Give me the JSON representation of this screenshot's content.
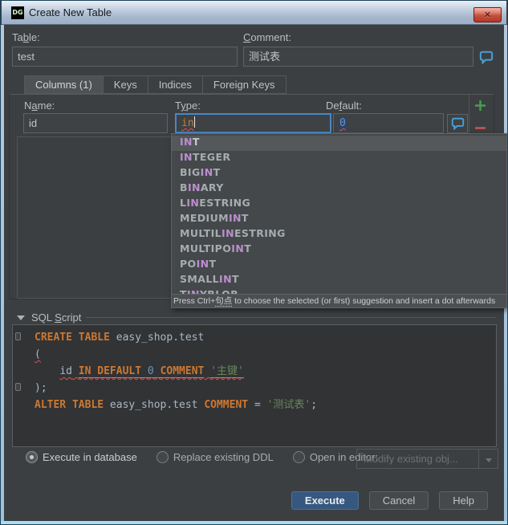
{
  "window": {
    "title": "Create New Table",
    "icon_text": "DG",
    "close_glyph": "✕"
  },
  "header": {
    "table_label": [
      "Ta",
      "b",
      "le:"
    ],
    "table_value": "test",
    "comment_label": [
      "",
      "C",
      "omment:"
    ],
    "comment_value": "测试表"
  },
  "tabs": [
    {
      "label": "Columns (1)",
      "active": true
    },
    {
      "label": "Keys",
      "active": false
    },
    {
      "label": "Indices",
      "active": false
    },
    {
      "label": "Foreign Keys",
      "active": false
    }
  ],
  "columns_tab": {
    "name_label": [
      "N",
      "a",
      "me:"
    ],
    "name_value": "id",
    "type_label": [
      "T",
      "y",
      "pe:"
    ],
    "type_value": "in",
    "default_label": [
      "De",
      "f",
      "ault:"
    ],
    "default_value": "0"
  },
  "completion": {
    "items": [
      {
        "pre": "",
        "match": "IN",
        "post": "T",
        "selected": true
      },
      {
        "pre": "",
        "match": "IN",
        "post": "TEGER",
        "selected": false
      },
      {
        "pre": "BIG",
        "match": "IN",
        "post": "T",
        "selected": false
      },
      {
        "pre": "B",
        "match": "IN",
        "post": "ARY",
        "selected": false
      },
      {
        "pre": "L",
        "match": "IN",
        "post": "ESTRING",
        "selected": false
      },
      {
        "pre": "MEDIUM",
        "match": "IN",
        "post": "T",
        "selected": false
      },
      {
        "pre": "MULTIL",
        "match": "IN",
        "post": "ESTRING",
        "selected": false
      },
      {
        "pre": "MULTIPO",
        "match": "IN",
        "post": "T",
        "selected": false
      },
      {
        "pre": "PO",
        "match": "IN",
        "post": "T",
        "selected": false
      },
      {
        "pre": "SMALL",
        "match": "IN",
        "post": "T",
        "selected": false
      },
      {
        "pre": "T",
        "match": "IN",
        "post": "YBLOB",
        "selected": false
      }
    ],
    "hint": [
      "Press Ctrl+",
      "句点",
      " to choose the selected (or first) suggestion and insert a dot afterwards"
    ]
  },
  "sql_section": {
    "label": [
      "SQL ",
      "S",
      "cript"
    ],
    "lines": [
      [
        [
          "CREATE TABLE",
          "kw"
        ],
        [
          " ",
          "pl"
        ],
        [
          "easy_shop.test",
          "idn"
        ]
      ],
      [
        [
          "(",
          "pl wv"
        ]
      ],
      [
        [
          "    ",
          "pl"
        ],
        [
          "id",
          "idn wv"
        ],
        [
          " ",
          "pl wv"
        ],
        [
          "IN DEFAULT",
          "kw wv u"
        ],
        [
          " ",
          "pl wv u"
        ],
        [
          "0",
          "num wv u"
        ],
        [
          " ",
          "pl wv u"
        ],
        [
          "COMMENT",
          "kw wv u"
        ],
        [
          " ",
          "pl wv"
        ],
        [
          "'主键'",
          "str wv u"
        ]
      ],
      [
        [
          ");",
          "pl"
        ]
      ],
      [
        [
          "ALTER TABLE",
          "kw"
        ],
        [
          " ",
          "pl"
        ],
        [
          "easy_shop.test",
          "idn"
        ],
        [
          " ",
          "pl"
        ],
        [
          "COMMENT",
          "kw"
        ],
        [
          " = ",
          "pl"
        ],
        [
          "'测试表'",
          "str"
        ],
        [
          ";",
          "pl"
        ]
      ]
    ]
  },
  "footer": {
    "radios": [
      {
        "label": "Execute in database",
        "selected": true
      },
      {
        "label": "Replace existing DDL",
        "selected": false
      },
      {
        "label": "Open in editor:",
        "selected": false
      }
    ],
    "combo_value": "Modify existing obj...",
    "buttons": [
      {
        "label": "Execute",
        "primary": true
      },
      {
        "label": "Cancel",
        "primary": false
      },
      {
        "label": "Help",
        "primary": false
      }
    ]
  },
  "colors": {
    "dialog_bg": "#3c3f41",
    "keyword": "#CC7832",
    "identifier": "#A9B7C6",
    "number": "#6897BB",
    "string": "#6A8759",
    "completion_match": "#BB8FCE",
    "add_icon": "#499C54",
    "remove_icon": "#C75450",
    "focus_border": "#4A87C4",
    "primary_button": "#365880",
    "bubble_icon": "#4A9FD8",
    "error_wave": "#E0524D"
  }
}
